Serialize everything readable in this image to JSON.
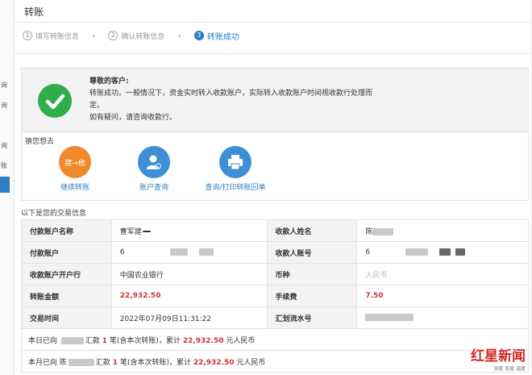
{
  "sidebar": {
    "items": [
      "询",
      "询",
      "询",
      "账"
    ]
  },
  "header": {
    "title": "转账"
  },
  "steps": [
    {
      "num": "1",
      "label": "填写转账信息"
    },
    {
      "num": "2",
      "label": "确认转账信息"
    },
    {
      "num": "3",
      "label": "转账成功"
    }
  ],
  "success": {
    "greeting": "尊敬的客户:",
    "line1": "转账成功。一般情况下，资金实时转入收款账户，实际转入收款账户时间视收款行处理而",
    "line2": "定。",
    "line3": "如有疑问，请咨询收款行。"
  },
  "guess": {
    "label": "猜您想去",
    "actions": [
      {
        "label": "继续转账",
        "icon_text": "建→他",
        "icon": "transfer-icon"
      },
      {
        "label": "账户查询",
        "icon": "user-search-icon"
      },
      {
        "label": "查询/打印转账回单",
        "icon": "printer-icon"
      }
    ]
  },
  "info": {
    "title": "以下是您的交易信息",
    "rows": [
      {
        "k1": "付款账户名称",
        "v1": "曹军建",
        "k2": "收款人姓名",
        "v2": "陈"
      },
      {
        "k1": "付款账户",
        "v1": "6",
        "k2": "收款人账号",
        "v2": "6"
      },
      {
        "k1": "收款账户开户行",
        "v1": "中国农业银行",
        "k2": "币种",
        "v2": "人民币"
      },
      {
        "k1": "转账金额",
        "v1": "22,932.50",
        "k2": "手续费",
        "v2": "7.50"
      },
      {
        "k1": "交易时间",
        "v1": "2022年07月09日11:31:22",
        "k2": "汇划流水号",
        "v2": ""
      }
    ],
    "summary1": {
      "prefix": "本日已向",
      "mid": "汇款",
      "count": "1",
      "text": "笔(含本次转账)，累计",
      "amount": "22,932.50",
      "suffix": "元人民币"
    },
    "summary2": {
      "prefix": "本月已向",
      "mid": "陈",
      "mid2": "汇款",
      "count": "1",
      "text": "笔(含本次转账)，累计",
      "amount": "22,932.50",
      "suffix": "元人民币"
    }
  },
  "watermark": {
    "brand": "红星新闻",
    "sub": "深度 态度 温度"
  },
  "colors": {
    "accent": "#2d7fc1",
    "success": "#2fae4a",
    "amount_red": "#c8363b",
    "orange": "#f08a2c"
  }
}
